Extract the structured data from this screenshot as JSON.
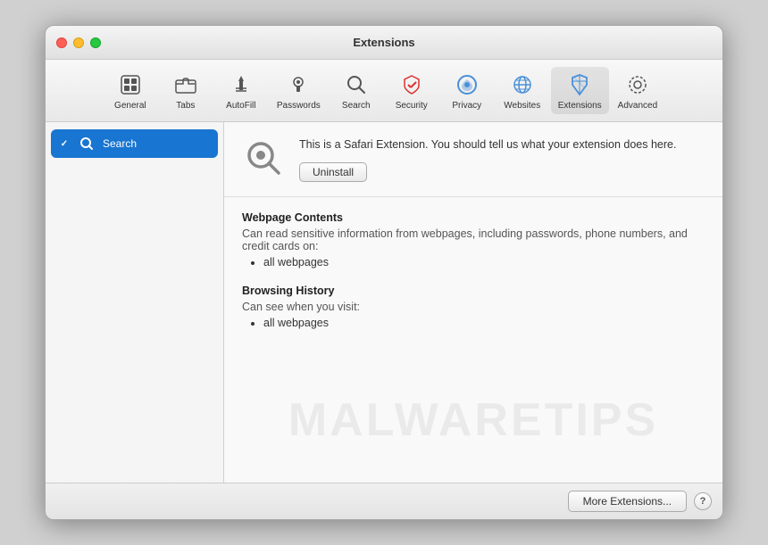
{
  "window": {
    "title": "Extensions"
  },
  "titlebar": {
    "title": "Extensions"
  },
  "toolbar": {
    "items": [
      {
        "id": "general",
        "label": "General",
        "icon": "general"
      },
      {
        "id": "tabs",
        "label": "Tabs",
        "icon": "tabs"
      },
      {
        "id": "autofill",
        "label": "AutoFill",
        "icon": "autofill"
      },
      {
        "id": "passwords",
        "label": "Passwords",
        "icon": "passwords"
      },
      {
        "id": "search",
        "label": "Search",
        "icon": "search"
      },
      {
        "id": "security",
        "label": "Security",
        "icon": "security"
      },
      {
        "id": "privacy",
        "label": "Privacy",
        "icon": "privacy"
      },
      {
        "id": "websites",
        "label": "Websites",
        "icon": "websites"
      },
      {
        "id": "extensions",
        "label": "Extensions",
        "icon": "extensions",
        "active": true
      },
      {
        "id": "advanced",
        "label": "Advanced",
        "icon": "advanced"
      }
    ]
  },
  "sidebar": {
    "items": [
      {
        "id": "search-ext",
        "name": "Search",
        "enabled": true,
        "selected": true
      }
    ]
  },
  "detail": {
    "description": "This is a Safari Extension. You should tell us what your extension does here.",
    "uninstall_label": "Uninstall",
    "permissions": {
      "webpage_contents": {
        "title": "Webpage Contents",
        "description": "Can read sensitive information from webpages, including passwords, phone numbers, and credit cards on:",
        "items": [
          "all webpages"
        ]
      },
      "browsing_history": {
        "title": "Browsing History",
        "description": "Can see when you visit:",
        "items": [
          "all webpages"
        ]
      }
    }
  },
  "footer": {
    "more_extensions_label": "More Extensions...",
    "help_label": "?"
  },
  "watermark": {
    "text": "MALWARETIPS"
  }
}
